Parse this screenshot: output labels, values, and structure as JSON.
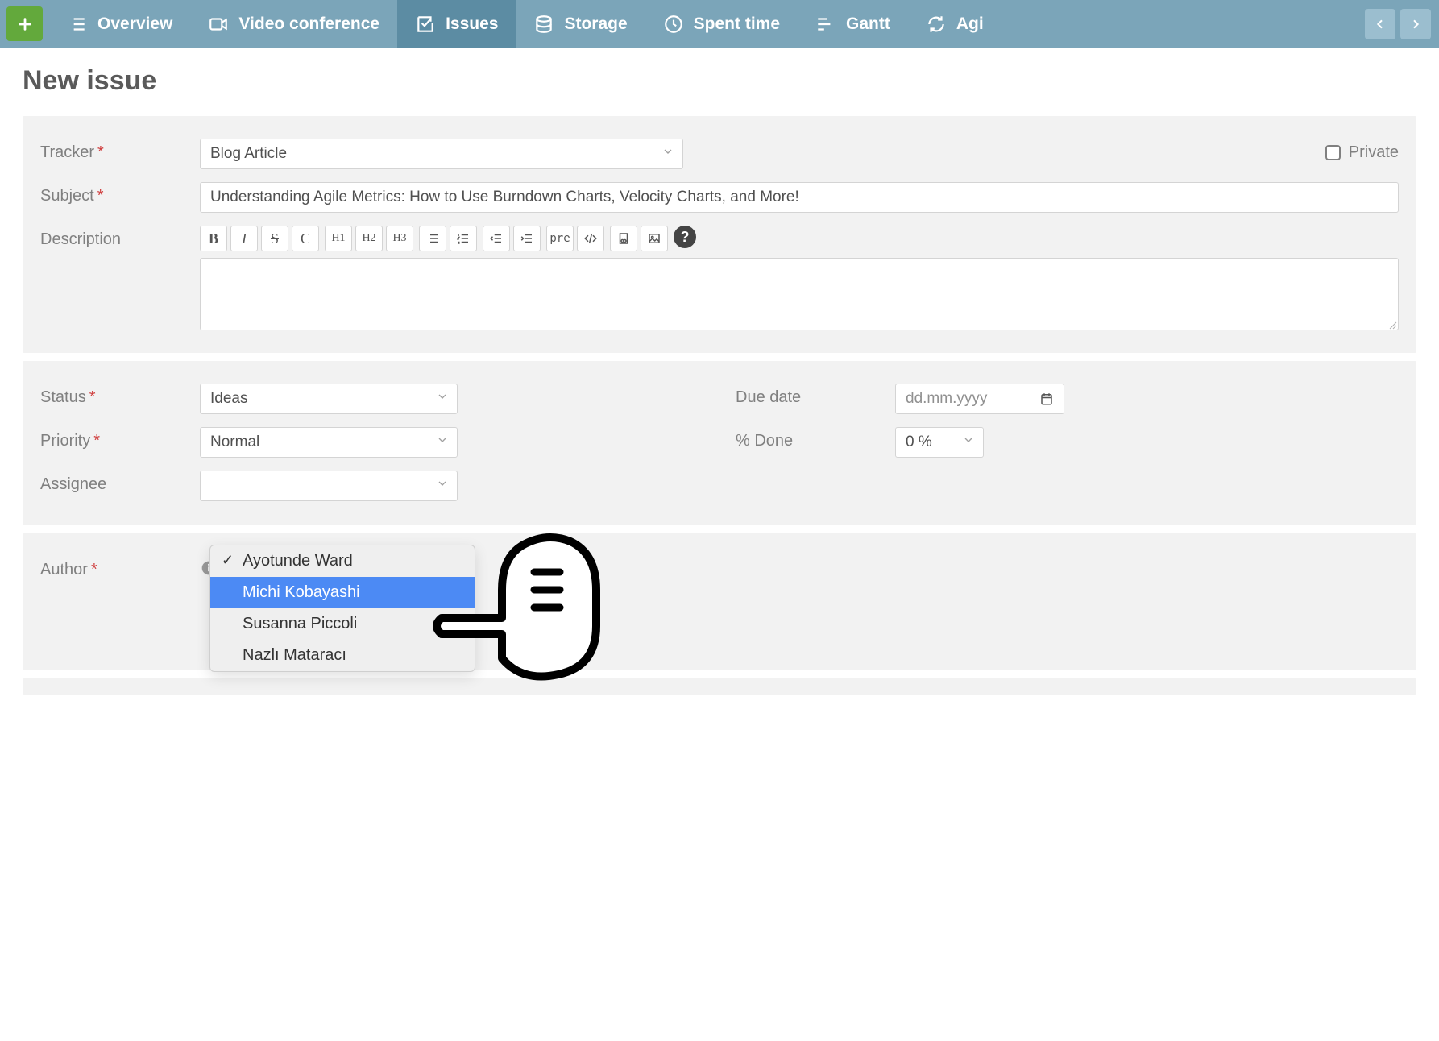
{
  "nav": {
    "items": [
      {
        "label": "Overview"
      },
      {
        "label": "Video conference"
      },
      {
        "label": "Issues",
        "active": true
      },
      {
        "label": "Storage"
      },
      {
        "label": "Spent time"
      },
      {
        "label": "Gantt"
      },
      {
        "label": "Agi"
      }
    ]
  },
  "page": {
    "title": "New issue"
  },
  "form": {
    "tracker": {
      "label": "Tracker",
      "value": "Blog Article"
    },
    "subject": {
      "label": "Subject",
      "value": "Understanding Agile Metrics: How to Use Burndown Charts, Velocity Charts, and More!"
    },
    "description": {
      "label": "Description"
    },
    "private": {
      "label": "Private"
    },
    "status": {
      "label": "Status",
      "value": "Ideas"
    },
    "priority": {
      "label": "Priority",
      "value": "Normal"
    },
    "assignee": {
      "label": "Assignee",
      "value": ""
    },
    "due_date": {
      "label": "Due date",
      "placeholder": "dd.mm.yyyy"
    },
    "percent_done": {
      "label": "% Done",
      "value": "0 %"
    },
    "author": {
      "label": "Author"
    }
  },
  "toolbar": {
    "bold": "B",
    "italic": "I",
    "strike": "S",
    "code_inline": "C",
    "h1": "H1",
    "h2": "H2",
    "h3": "H3",
    "pre": "pre"
  },
  "author_options": [
    {
      "label": "Ayotunde Ward",
      "checked": true
    },
    {
      "label": "Michi Kobayashi",
      "highlight": true
    },
    {
      "label": "Susanna Piccoli"
    },
    {
      "label": "Nazlı Mataracı"
    }
  ]
}
